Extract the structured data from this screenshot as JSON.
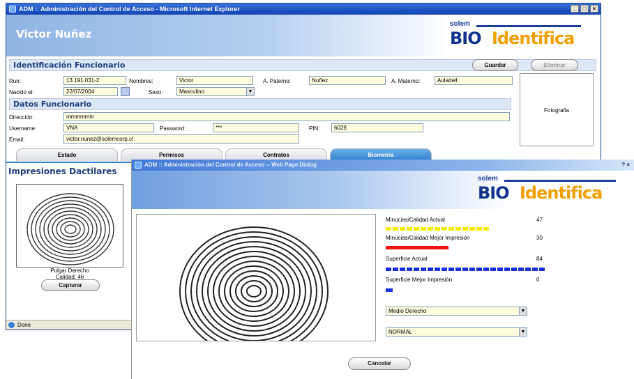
{
  "main_window": {
    "title": "ADM :: Administración del Control de Acceso - Microsoft Internet Explorer",
    "controls": [
      "_",
      "□",
      "×"
    ],
    "user_name": "Victor Nuñez",
    "brand": {
      "solem": "solem",
      "bio": "BIO",
      "identifica": "Identifica"
    },
    "identificacion": {
      "title": "Identificación Funcionario",
      "guardar": "Guardar",
      "eliminar": "Eliminar",
      "run_label": "Run:",
      "run_value": "13.191.031-2",
      "nombres_label": "Nombres:",
      "nombres_value": "Victor",
      "paterno_label": "A. Paterno:",
      "paterno_value": "Nuñez",
      "materno_label": "A. Materno:",
      "materno_value": "Auladell",
      "nacido_label": "Nacido el:",
      "nacido_value": "22/07/2004",
      "sexo_label": "Sexo:",
      "sexo_value": "Masculino"
    },
    "datos": {
      "title": "Datos Funcionario",
      "direccion_label": "Dirección:",
      "direccion_value": "mmmmmm",
      "username_label": "Username:",
      "username_value": "VNA",
      "password_label": "Password:",
      "password_value": "***",
      "pin_label": "PIN:",
      "pin_value": "6029",
      "email_label": "Email:",
      "email_value": "victor.nunez@solemcorp.cl"
    },
    "foto_label": "Fotografia",
    "tabs": [
      "Estado",
      "Permisos",
      "Contratos",
      "Biometria"
    ],
    "impresiones": {
      "title": "Impresiones Dactilares",
      "finger": "Pulgar Derecho",
      "quality": "Calidad: 46",
      "capturar": "Capturar"
    },
    "status": "Done"
  },
  "dialog": {
    "title": "ADM :: Administración del Control de Acceso -- Web Page Dialog",
    "help": "?",
    "close": "×",
    "metrics": [
      {
        "label": "Minucias/Calidad Actual",
        "value": "47",
        "color": "#f2ee00",
        "segments": 15,
        "level": 0.47
      },
      {
        "label": "Minucias/Calidad Mejor Impresión",
        "value": "30",
        "color": "#ee1111",
        "segments": 1,
        "level": 0.3
      },
      {
        "label": "Superficie Actual",
        "value": "84",
        "color": "#1a2fe0",
        "segments": 23,
        "level": 0.84
      },
      {
        "label": "Superficie Mejor Impresión",
        "value": "0",
        "color": "#1a2fe0",
        "segments": 1,
        "level": 0.0
      }
    ],
    "finger_select": "Medio Derecho",
    "mode_select": "NORMAL",
    "cancelar": "Cancelar"
  }
}
